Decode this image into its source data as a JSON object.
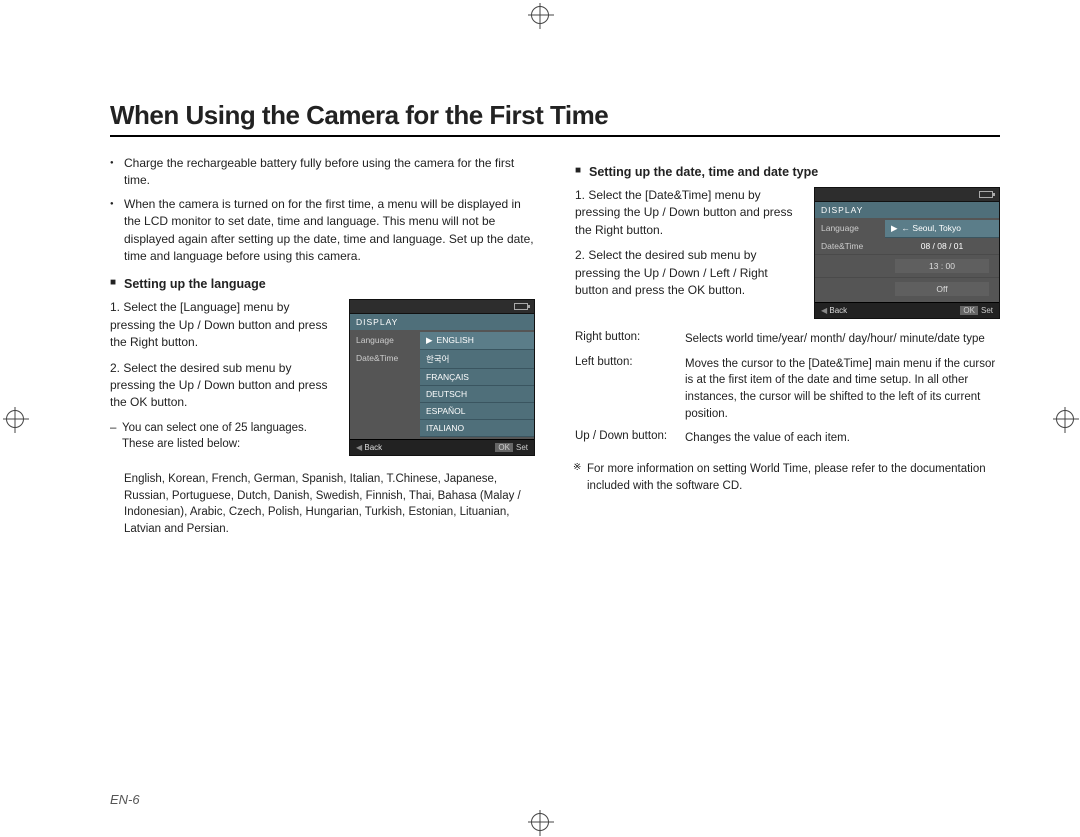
{
  "title": "When Using the Camera for the First Time",
  "bullets": [
    "Charge the rechargeable battery fully before using the camera for the first time.",
    "When the camera is turned on for the first time, a menu will be displayed in the LCD monitor to set date, time and language. This menu will not be displayed again after setting up the date, time and language. Set up the date, time and language before using this camera."
  ],
  "lang_section": {
    "heading": "Setting up the language",
    "step1": "Select the [Language] menu by pressing the Up / Down button and press the Right button.",
    "step2": "Select the desired sub menu by pressing the Up / Down button and press the OK button.",
    "note_intro": "You can select one of 25 languages. These are listed below:",
    "languages": "English, Korean, French, German, Spanish, Italian, T.Chinese, Japanese, Russian, Portuguese, Dutch, Danish, Swedish, Finnish, Thai, Bahasa (Malay / Indonesian), Arabic, Czech, Polish, Hungarian, Turkish, Estonian, Lituanian, Latvian and Persian."
  },
  "lcd_lang": {
    "title": "DISPLAY",
    "left1": "Language",
    "left2": "Date&Time",
    "opts": [
      "ENGLISH",
      "한국어",
      "FRANÇAIS",
      "DEUTSCH",
      "ESPAÑOL",
      "ITALIANO"
    ],
    "foot_back": "Back",
    "foot_ok": "OK",
    "foot_set": "Set"
  },
  "date_section": {
    "heading": "Setting up the date, time and date type",
    "step1": "Select the [Date&Time] menu by pressing the Up / Down button and press the Right button.",
    "step2": "Select the desired sub menu by pressing the Up / Down / Left / Right button and press the OK button.",
    "tbl": [
      {
        "k": "Right button:",
        "v": "Selects world time/year/ month/ day/hour/ minute/date type"
      },
      {
        "k": "Left button:",
        "v": "Moves the cursor to the [Date&Time] main menu if the cursor is at the first item of the date and time setup. In all other instances, the cursor will be shifted to the left of its current position."
      },
      {
        "k": "Up / Down button:",
        "v": "Changes the value of each item."
      }
    ],
    "footnote": "For more information on setting World Time, please refer to the documentation included with the software CD."
  },
  "lcd_date": {
    "title": "DISPLAY",
    "left1": "Language",
    "left2": "Date&Time",
    "val_city": "← Seoul, Tokyo",
    "val_date": "08 / 08 / 01",
    "val_time": "13 : 00",
    "val_off": "Off",
    "foot_back": "Back",
    "foot_ok": "OK",
    "foot_set": "Set"
  },
  "page_num": "EN-6"
}
